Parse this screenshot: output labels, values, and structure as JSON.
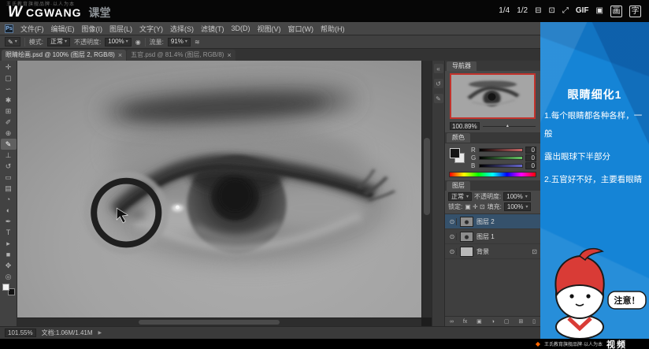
{
  "icons": {
    "caret": "▾",
    "slider_thumb": "▴"
  },
  "top_bar": {
    "watermark": "王氏教育旗舰品牌·以人为本",
    "logo_mark": "W",
    "logo_text": "CGWANG",
    "logo_sub": "课堂",
    "controls": [
      {
        "name": "speed-quarter",
        "label": "1/4"
      },
      {
        "name": "speed-half",
        "label": "1/2"
      },
      {
        "name": "pen-panel-icon",
        "label": "⊟"
      },
      {
        "name": "monitor-icon",
        "label": "⊡"
      },
      {
        "name": "fullscreen-icon",
        "label": "⤢"
      },
      {
        "name": "gif-button",
        "label": "GIF"
      },
      {
        "name": "snapshot-icon",
        "label": "▣"
      },
      {
        "name": "draw-button",
        "label": "画"
      },
      {
        "name": "text-button",
        "label": "字"
      }
    ]
  },
  "menu_items": [
    "文件(F)",
    "编辑(E)",
    "图像(I)",
    "图层(L)",
    "文字(Y)",
    "选择(S)",
    "滤镜(T)",
    "3D(D)",
    "视图(V)",
    "窗口(W)",
    "帮助(H)"
  ],
  "ps_icon": "Ps",
  "options": {
    "brush_icon": "✎",
    "mode_label": "模式:",
    "mode_value": "正常",
    "opacity_label": "不透明度:",
    "opacity_value": "100%",
    "pressure_icon": "◉",
    "flow_label": "流量:",
    "flow_value": "91%",
    "airbrush_icon": "≋"
  },
  "tabs": [
    {
      "label": "眼睛绘画.psd @ 100% (图层 2, RGB/8)",
      "close": "×"
    },
    {
      "label": "五官.psd @ 81.4% (图层, RGB/8)",
      "close": "×"
    }
  ],
  "tools": [
    {
      "name": "move-tool",
      "glyph": "✛"
    },
    {
      "name": "marquee-tool",
      "glyph": "▢"
    },
    {
      "name": "lasso-tool",
      "glyph": "∽"
    },
    {
      "name": "quick-selection-tool",
      "glyph": "✱"
    },
    {
      "name": "crop-tool",
      "glyph": "⊞"
    },
    {
      "name": "eyedropper-tool",
      "glyph": "✐"
    },
    {
      "name": "healing-brush-tool",
      "glyph": "⊕"
    },
    {
      "name": "brush-tool",
      "glyph": "✎"
    },
    {
      "name": "clone-stamp-tool",
      "glyph": "⊥"
    },
    {
      "name": "history-brush-tool",
      "glyph": "↺"
    },
    {
      "name": "eraser-tool",
      "glyph": "▭"
    },
    {
      "name": "gradient-tool",
      "glyph": "▤"
    },
    {
      "name": "blur-tool",
      "glyph": "◔"
    },
    {
      "name": "dodge-tool",
      "glyph": "◐"
    },
    {
      "name": "pen-tool",
      "glyph": "✒"
    },
    {
      "name": "type-tool",
      "glyph": "T"
    },
    {
      "name": "path-selection-tool",
      "glyph": "▸"
    },
    {
      "name": "shape-tool",
      "glyph": "■"
    },
    {
      "name": "hand-tool",
      "glyph": "✥"
    },
    {
      "name": "zoom-tool",
      "glyph": "◎"
    }
  ],
  "dock_icons": [
    {
      "name": "collapse-dock-icon",
      "glyph": "«"
    },
    {
      "name": "history-panel-icon",
      "glyph": "↺"
    },
    {
      "name": "brushes-panel-icon",
      "glyph": "✎"
    }
  ],
  "navigator": {
    "title": "导航器",
    "zoom": "100.89%"
  },
  "color_panel": {
    "title": "颜色",
    "rows": [
      {
        "label": "R",
        "value": "0"
      },
      {
        "label": "G",
        "value": "0"
      },
      {
        "label": "B",
        "value": "0"
      }
    ]
  },
  "layers_panel": {
    "title": "图层",
    "blend_mode": "正常",
    "opacity_label": "不透明度:",
    "opacity_value": "100%",
    "lock_label": "锁定:",
    "lock_icons": "▣ ✛ ⊡",
    "fill_label": "填充:",
    "fill_value": "100%",
    "visibility_icon": "⊙",
    "rows": [
      {
        "name": "图层 2"
      },
      {
        "name": "图层 1"
      },
      {
        "name": "背景",
        "lock": "⊡"
      }
    ],
    "footer_icons": [
      {
        "name": "link-layers-icon",
        "glyph": "∞"
      },
      {
        "name": "layer-effects-icon",
        "glyph": "fx"
      },
      {
        "name": "layer-mask-icon",
        "glyph": "▣"
      },
      {
        "name": "adjustment-layer-icon",
        "glyph": "◑"
      },
      {
        "name": "layer-group-icon",
        "glyph": "▢"
      },
      {
        "name": "new-layer-icon",
        "glyph": "⊞"
      },
      {
        "name": "delete-layer-icon",
        "glyph": "▯"
      }
    ]
  },
  "status_bar": {
    "zoom": "101.55%",
    "doc_info": "文档:1.06M/1.41M",
    "arrow": "▶"
  },
  "sidebar": {
    "title": "眼睛细化1",
    "line1": "1.每个眼睛都各种各样，一般",
    "line2": "露出眼球下半部分",
    "line3": "2.五官好不好，主要看眼睛",
    "bubble": "注意！"
  },
  "bottom_bar": {
    "brand_small": "王氏教育旗舰品牌·以人为本",
    "brand_big": "视频"
  }
}
